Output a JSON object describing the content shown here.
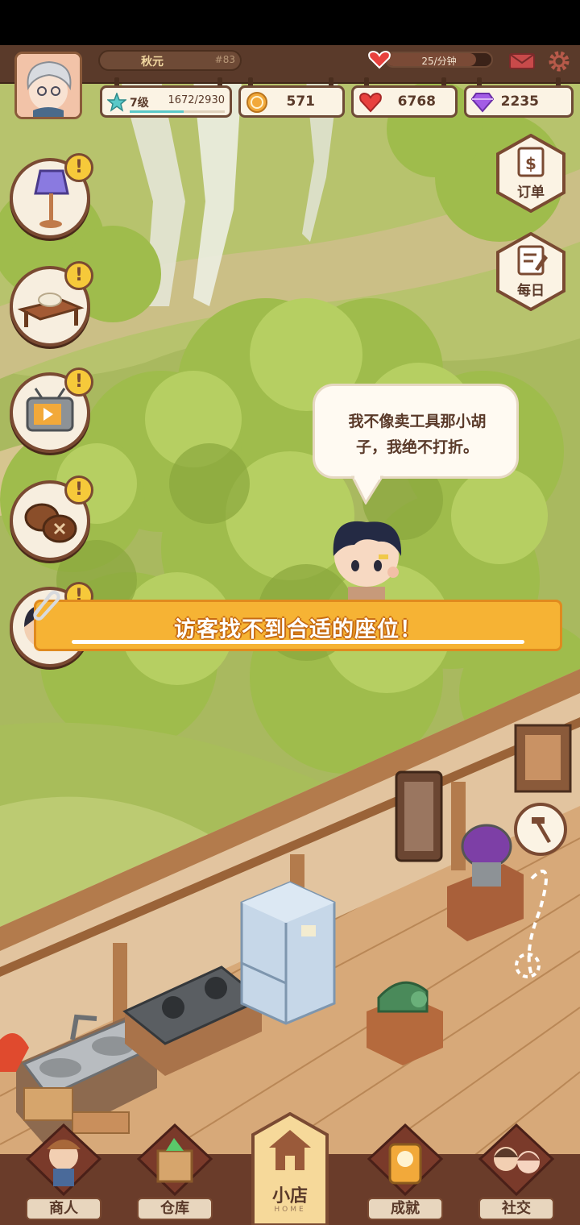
{
  "player": {
    "name": "秋元",
    "id": "#83",
    "level": "7级",
    "xp": "1672/2930",
    "xp_fraction": 0.57
  },
  "energy": {
    "rate": "25/分钟",
    "fill_fraction": 0.85
  },
  "currencies": {
    "coins": "571",
    "hearts": "6768",
    "gems": "2235"
  },
  "right_buttons": {
    "orders_label": "订单",
    "daily_label": "每日"
  },
  "speech_bubble": {
    "line1": "我不像卖工具那小胡",
    "line2": "子，我绝不打折。"
  },
  "notice": {
    "text": "访客找不到合适的座位！"
  },
  "alerts": {
    "mark": "!"
  },
  "nav": {
    "merchant": "商人",
    "warehouse": "仓库",
    "home": "小店",
    "home_sub": "HOME",
    "achievements": "成就",
    "social": "社交"
  },
  "colors": {
    "hud_brown": "#5a3a2a",
    "banner_orange": "#f6b334",
    "alert_yellow": "#f6c93a",
    "gem_purple": "#a35ce6",
    "heart_red": "#e8413e"
  },
  "icons": [
    "lamp-icon",
    "tea-table-icon",
    "tv-icon",
    "mushroom-icon",
    "mail-icon",
    "settings-gear-icon",
    "coin-icon",
    "heart-icon",
    "gem-icon",
    "star-level-icon",
    "order-book-icon",
    "daily-notebook-icon",
    "hammer-icon",
    "home-shop-icon"
  ]
}
